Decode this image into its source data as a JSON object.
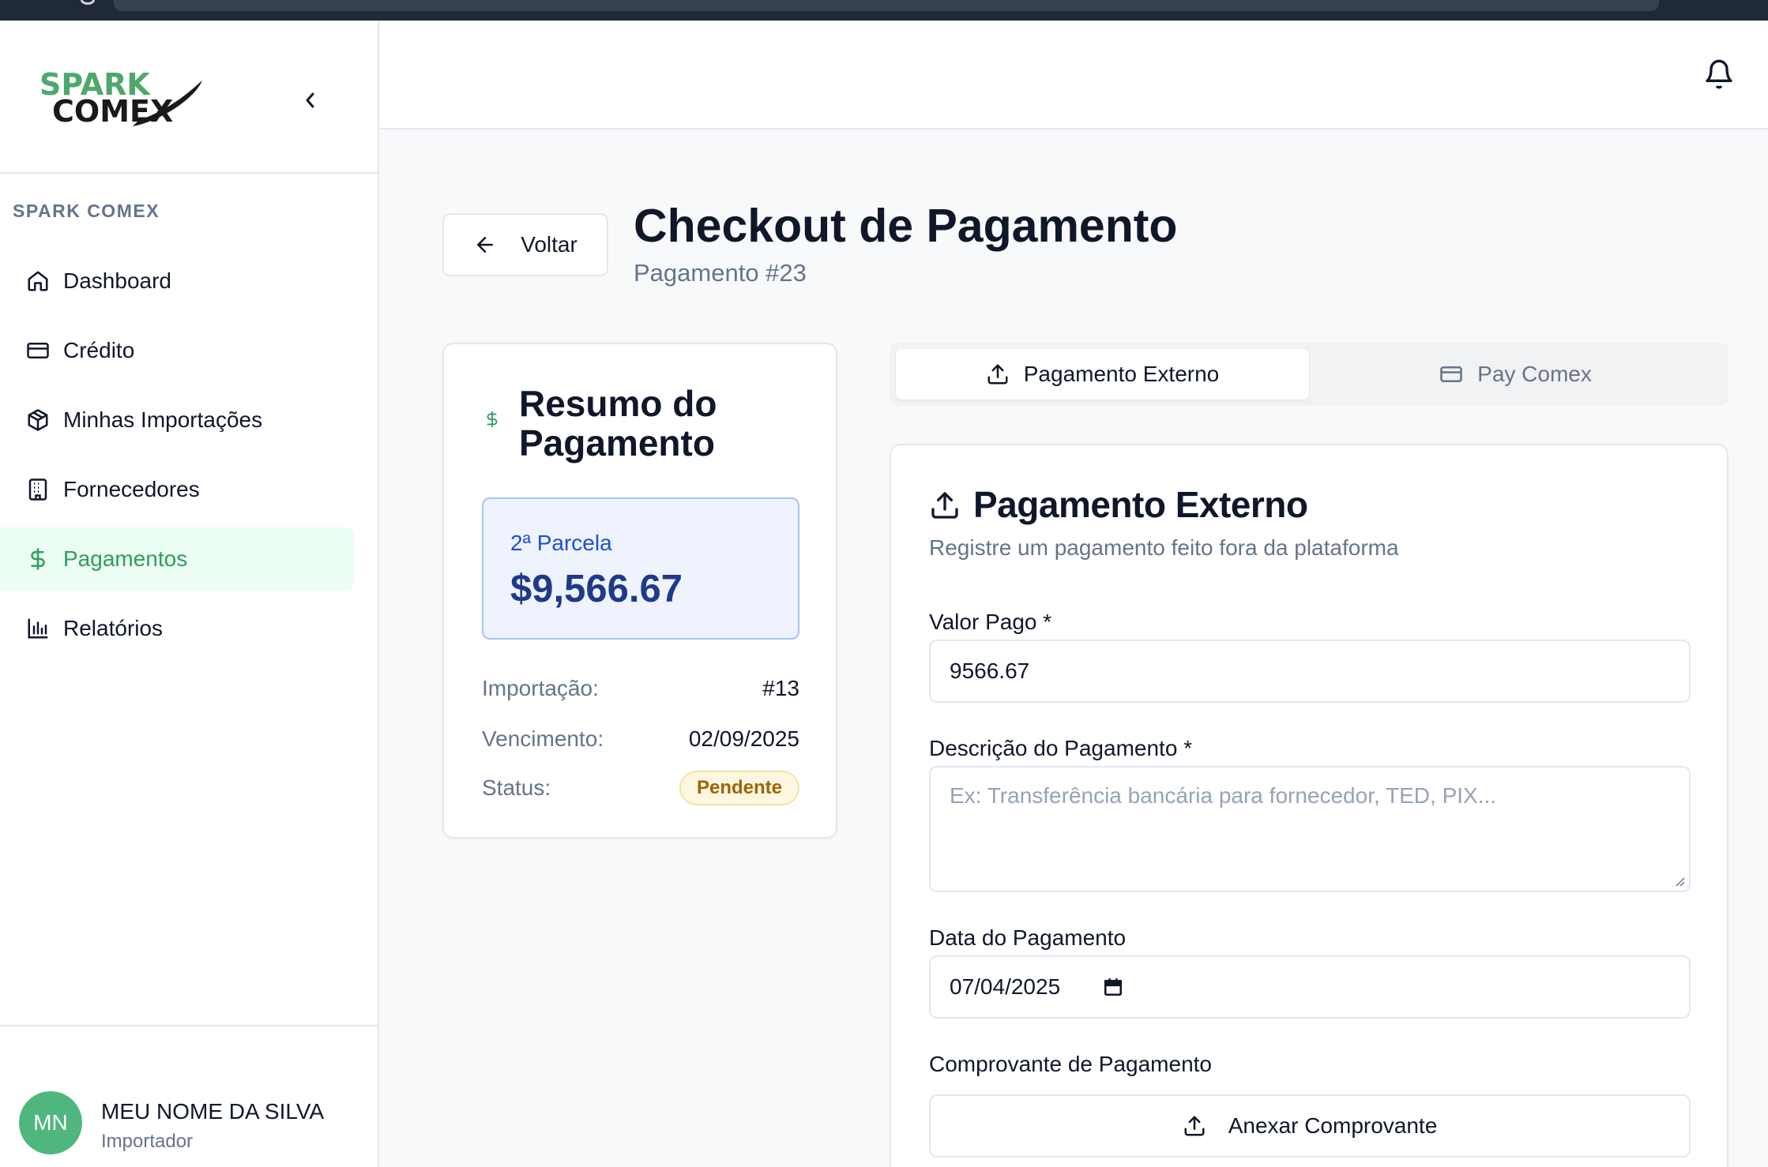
{
  "brand": {
    "logo_top": "SPARK",
    "logo_bottom": "COMEX",
    "primary_color": "#2e9d5f",
    "logo_green": "#4ea86c",
    "logo_dark": "#1a1a1a"
  },
  "sidebar": {
    "section_label": "SPARK COMEX",
    "collapse_icon": "chevron-left-icon",
    "items": [
      {
        "label": "Dashboard",
        "icon": "home-icon",
        "active": false
      },
      {
        "label": "Crédito",
        "icon": "credit-card-icon",
        "active": false
      },
      {
        "label": "Minhas Importações",
        "icon": "package-icon",
        "active": false
      },
      {
        "label": "Fornecedores",
        "icon": "building-icon",
        "active": false
      },
      {
        "label": "Pagamentos",
        "icon": "dollar-icon",
        "active": true
      },
      {
        "label": "Relatórios",
        "icon": "bar-chart-icon",
        "active": false
      }
    ],
    "user": {
      "initials": "MN",
      "name": "MEU NOME DA SILVA",
      "role": "Importador"
    }
  },
  "topbar": {
    "notification_icon": "bell-icon"
  },
  "header": {
    "back_label": "Voltar",
    "title": "Checkout de Pagamento",
    "subtitle": "Pagamento #23"
  },
  "summary": {
    "title": "Resumo do Pagamento",
    "installment_label": "2ª Parcela",
    "amount": "$9,566.67",
    "rows": [
      {
        "key": "Importação:",
        "value": "#13"
      },
      {
        "key": "Vencimento:",
        "value": "02/09/2025"
      },
      {
        "key": "Status:",
        "value": "Pendente"
      }
    ]
  },
  "tabs": [
    {
      "label": "Pagamento Externo",
      "icon": "upload-icon",
      "active": true
    },
    {
      "label": "Pay Comex",
      "icon": "credit-card-icon",
      "active": false
    }
  ],
  "form": {
    "title": "Pagamento Externo",
    "subtitle": "Registre um pagamento feito fora da plataforma",
    "amount_label": "Valor Pago *",
    "amount_value": "9566.67",
    "description_label": "Descrição do Pagamento *",
    "description_placeholder": "Ex: Transferência bancária para fornecedor, TED, PIX...",
    "date_label": "Data do Pagamento",
    "date_value": "07/04/2025",
    "receipt_label": "Comprovante de Pagamento",
    "attach_label": "Anexar Comprovante"
  }
}
